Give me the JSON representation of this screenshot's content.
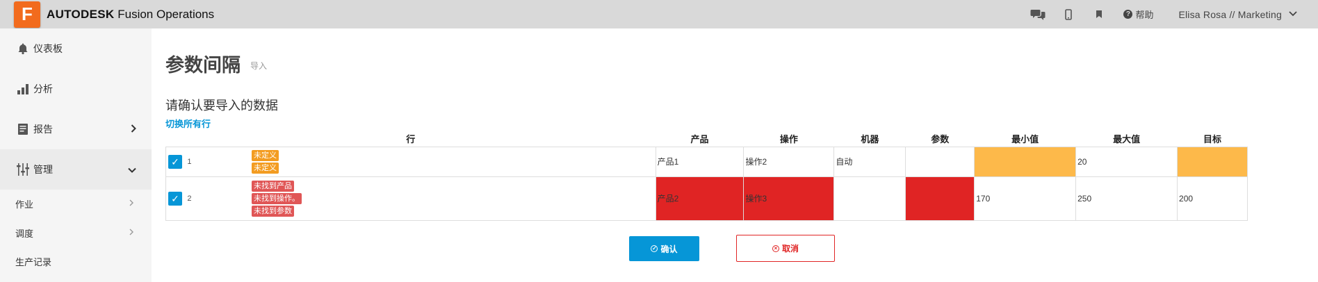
{
  "header": {
    "logo_letter": "F",
    "brand": "AUTODESK",
    "product": "Fusion Operations",
    "help_label": "帮助",
    "user_label": "Elisa Rosa // Marketing",
    "accent": "#f26b1d"
  },
  "sidebar": {
    "items": [
      {
        "label": "仪表板",
        "icon": "bell-icon"
      },
      {
        "label": "分析",
        "icon": "bar-chart-icon"
      },
      {
        "label": "报告",
        "icon": "report-icon"
      },
      {
        "label": "管理",
        "icon": "sliders-icon"
      }
    ],
    "sub_items": [
      {
        "label": "作业"
      },
      {
        "label": "调度"
      },
      {
        "label": "生产记录"
      }
    ]
  },
  "main": {
    "title": "参数间隔",
    "subtitle": "导入",
    "section_title": "请确认要导入的数据",
    "toggle_all_label": "切换所有行",
    "columns": [
      "行",
      "产品",
      "操作",
      "机器",
      "参数",
      "最小值",
      "最大值",
      "目标"
    ],
    "rows": [
      {
        "num": "1",
        "checked": true,
        "badges": [
          {
            "text": "未定义",
            "color": "orange"
          },
          {
            "text": "未定义",
            "color": "orange"
          }
        ],
        "product": "产品1",
        "operation": "操作2",
        "machine": "自动",
        "parameter": "",
        "min": "",
        "max": "20",
        "target": ""
      },
      {
        "num": "2",
        "checked": true,
        "badges": [
          {
            "text": "未找到产品",
            "color": "red"
          },
          {
            "text": "未找到操作。",
            "color": "red"
          },
          {
            "text": "未找到参数",
            "color": "red"
          }
        ],
        "product": "产品2",
        "operation": "操作3",
        "machine": "",
        "parameter": "",
        "min": "170",
        "max": "250",
        "target": "200"
      }
    ],
    "confirm_label": "确认",
    "cancel_label": "取消",
    "colors": {
      "primary": "#0696d7",
      "warning": "#fdb94a",
      "error": "#e02424"
    }
  }
}
